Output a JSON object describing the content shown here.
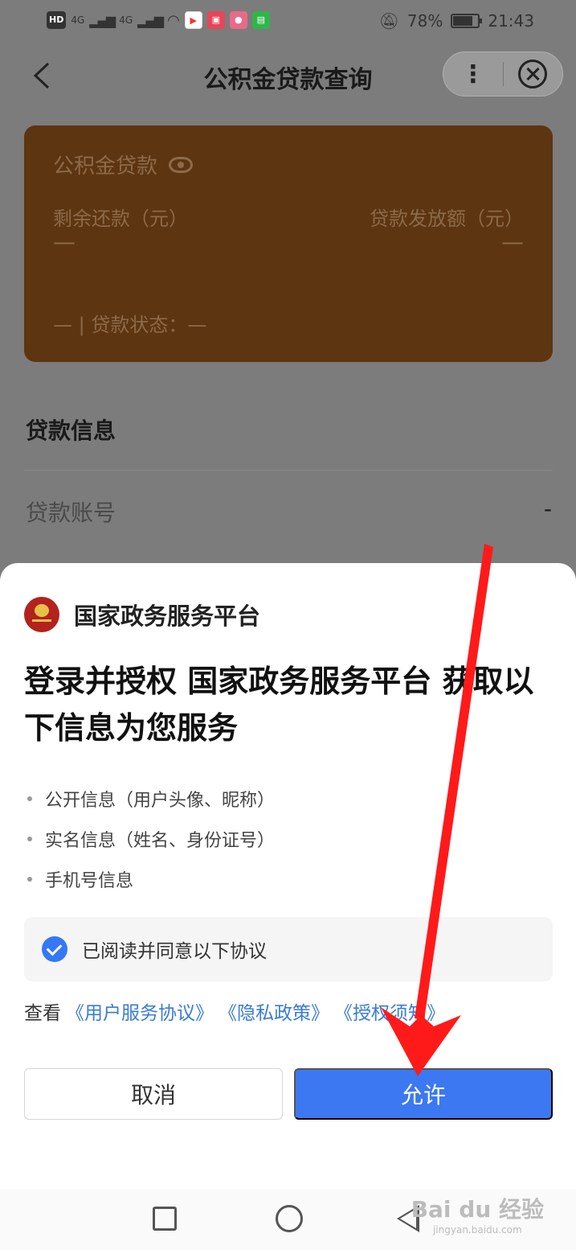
{
  "status_bar": {
    "left_label": "HD",
    "signal_1": "4G",
    "signal_2": "4G",
    "battery": "78%",
    "battery_level": 0.78,
    "time": "21:43"
  },
  "nav": {
    "title": "公积金贷款查询",
    "more_icon": "⋮"
  },
  "loan_card": {
    "title": "公积金贷款",
    "remaining_label": "剩余还款（元）",
    "issued_label": "贷款发放额（元）",
    "remaining_value": "—",
    "issued_value": "—",
    "status_text": "— | 贷款状态：—"
  },
  "loan_info": {
    "section_title": "贷款信息",
    "account_label": "贷款账号",
    "account_value": "-"
  },
  "auth_sheet": {
    "org_name": "国家政务服务平台",
    "heading": "登录并授权 国家政务服务平台 获取以下信息为您服务",
    "permissions": [
      "公开信息（用户头像、昵称）",
      "实名信息（姓名、身份证号）",
      "手机号信息"
    ],
    "agree_text": "已阅读并同意以下协议",
    "agree_checked": true,
    "view_prefix": "查看",
    "links": [
      "《用户服务协议》",
      "《隐私政策》",
      "《授权须知》"
    ],
    "cancel_label": "取消",
    "allow_label": "允许"
  },
  "watermark": {
    "top": "Bai du 经验",
    "bottom": "jingyan.baidu.com"
  },
  "colors": {
    "primary": "#3c78f2",
    "card_bg": "#5d3510",
    "link": "#3a7bd5",
    "annotation_arrow": "#ff0000"
  }
}
